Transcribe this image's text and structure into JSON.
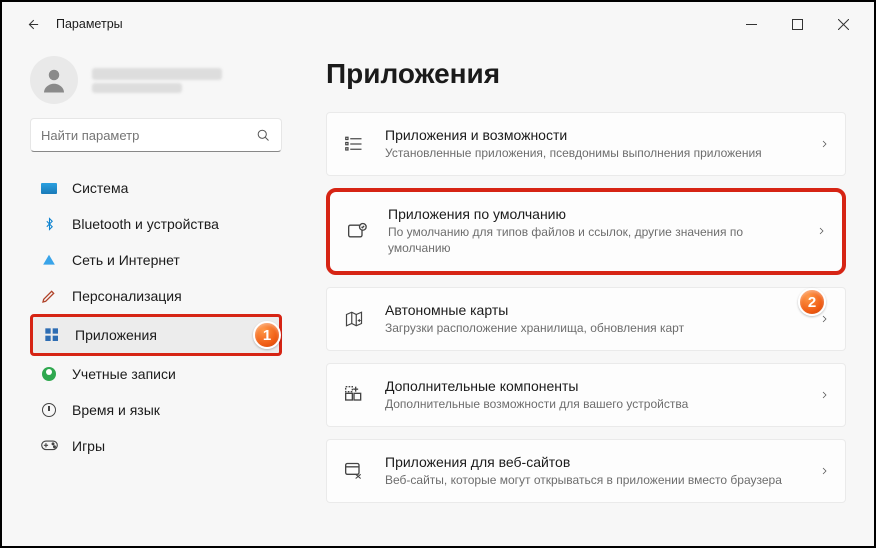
{
  "window": {
    "title": "Параметры"
  },
  "search": {
    "placeholder": "Найти параметр"
  },
  "sidebar": {
    "items": [
      {
        "label": "Система"
      },
      {
        "label": "Bluetooth и устройства"
      },
      {
        "label": "Сеть и Интернет"
      },
      {
        "label": "Персонализация"
      },
      {
        "label": "Приложения"
      },
      {
        "label": "Учетные записи"
      },
      {
        "label": "Время и язык"
      },
      {
        "label": "Игры"
      }
    ]
  },
  "page": {
    "title": "Приложения"
  },
  "cards": [
    {
      "title": "Приложения и возможности",
      "desc": "Установленные приложения, псевдонимы выполнения приложения"
    },
    {
      "title": "Приложения по умолчанию",
      "desc": "По умолчанию для типов файлов и ссылок, другие значения по умолчанию"
    },
    {
      "title": "Автономные карты",
      "desc": "Загрузки расположение хранилища, обновления карт"
    },
    {
      "title": "Дополнительные компоненты",
      "desc": "Дополнительные возможности для вашего устройства"
    },
    {
      "title": "Приложения для веб-сайтов",
      "desc": "Веб-сайты, которые могут открываться в приложении вместо браузера"
    }
  ],
  "annotations": {
    "badge1": "1",
    "badge2": "2"
  },
  "colors": {
    "highlight": "#d62414",
    "badge_fill": "#ef5a12"
  }
}
